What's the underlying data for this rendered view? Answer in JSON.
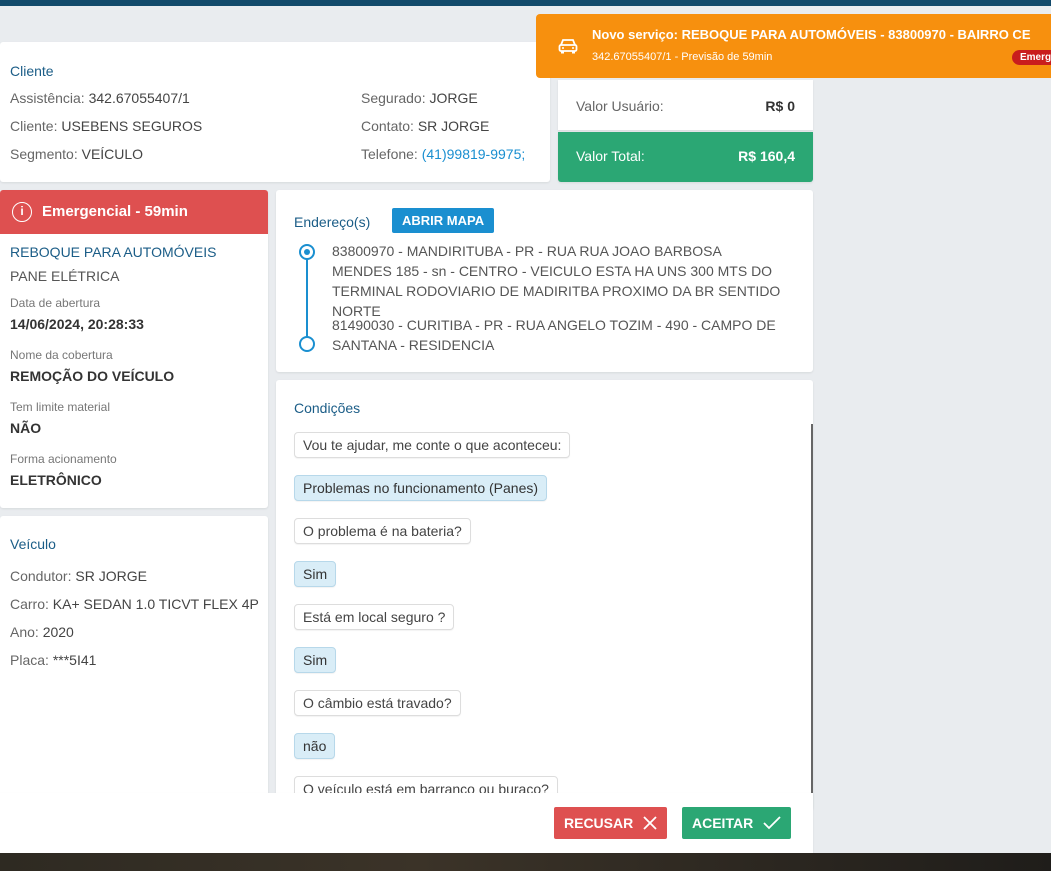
{
  "cliente": {
    "title": "Cliente",
    "assistencia_label": "Assistência:",
    "assistencia_value": "342.67055407/1",
    "cliente_label": "Cliente:",
    "cliente_value": "USEBENS SEGUROS",
    "segmento_label": "Segmento:",
    "segmento_value": "VEÍCULO",
    "segurado_label": "Segurado:",
    "segurado_value": "JORGE",
    "contato_label": "Contato:",
    "contato_value": "SR JORGE",
    "telefone_label": "Telefone:",
    "telefone_value": "(41)99819-9975;"
  },
  "valores": {
    "usuario_label": "Valor Usuário:",
    "usuario_value": "R$ 0",
    "total_label": "Valor Total:",
    "total_value": "R$ 160,4"
  },
  "toast": {
    "title": "Novo serviço: REBOQUE PARA AUTOMÓVEIS - 83800970 - BAIRRO CE",
    "subtitle": "342.67055407/1 - Previsão de 59min",
    "badge": "Emerg"
  },
  "servico": {
    "header": "Emergencial - 59min",
    "name": "REBOQUE PARA AUTOMÓVEIS",
    "sub": "PANE ELÉTRICA",
    "data_label": "Data de abertura",
    "data_value": "14/06/2024, 20:28:33",
    "cobertura_label": "Nome da cobertura",
    "cobertura_value": "REMOÇÃO DO VEÍCULO",
    "limite_label": "Tem limite material",
    "limite_value": "NÃO",
    "forma_label": "Forma acionamento",
    "forma_value": "ELETRÔNICO"
  },
  "veiculo": {
    "title": "Veículo",
    "condutor_label": "Condutor:",
    "condutor_value": "SR JORGE",
    "carro_label": "Carro:",
    "carro_value": "KA+ SEDAN 1.0 TICVT FLEX 4P",
    "ano_label": "Ano:",
    "ano_value": "2020",
    "placa_label": "Placa:",
    "placa_value": "***5I41"
  },
  "endereco": {
    "title": "Endereço(s)",
    "map_button": "ABRIR MAPA",
    "origin": "83800970 - MANDIRITUBA - PR - RUA RUA JOAO BARBOSA MENDES 185 - sn - CENTRO - VEICULO ESTA HA UNS 300 MTS DO TERMINAL RODOVIARIO DE MADIRITBA PROXIMO DA BR SENTIDO NORTE",
    "destination": "81490030 - CURITIBA - PR - RUA ANGELO TOZIM - 490 - CAMPO DE SANTANA - RESIDENCIA"
  },
  "condicoes": {
    "title": "Condições",
    "items": [
      "Vou te ajudar, me conte o que aconteceu:",
      "Problemas no funcionamento (Panes)",
      "O problema é na bateria?",
      "Sim",
      "Está em local seguro ?",
      "Sim",
      "O câmbio está travado?",
      "não",
      "O veículo está em barranco ou buraco?"
    ]
  },
  "footer": {
    "recusar": "RECUSAR",
    "aceitar": "ACEITAR"
  }
}
